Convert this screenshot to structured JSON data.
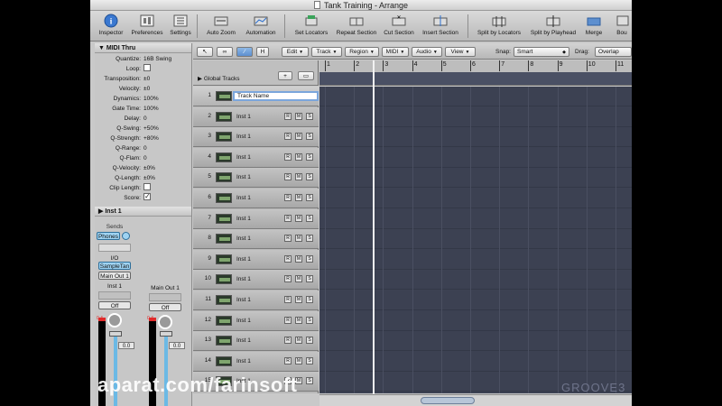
{
  "window": {
    "title": "Tank Training - Arrange"
  },
  "toolbar": {
    "items": [
      {
        "label": "Inspector",
        "icon": "info-icon"
      },
      {
        "label": "Preferences",
        "icon": "preferences-icon"
      },
      {
        "label": "Settings",
        "icon": "settings-icon"
      },
      {
        "label": "Auto Zoom",
        "icon": "auto-zoom-icon"
      },
      {
        "label": "Automation",
        "icon": "automation-icon"
      },
      {
        "label": "Set Locators",
        "icon": "set-locators-icon"
      },
      {
        "label": "Repeat Section",
        "icon": "repeat-section-icon"
      },
      {
        "label": "Cut Section",
        "icon": "cut-section-icon"
      },
      {
        "label": "Insert Section",
        "icon": "insert-section-icon"
      },
      {
        "label": "Split by Locators",
        "icon": "split-locators-icon"
      },
      {
        "label": "Split by Playhead",
        "icon": "split-playhead-icon"
      },
      {
        "label": "Merge",
        "icon": "merge-icon"
      },
      {
        "label": "Bou",
        "icon": "bounce-icon"
      }
    ]
  },
  "inspector": {
    "region_header": "MIDI Thru",
    "params": [
      {
        "label": "Quantize:",
        "value": "16B Swing"
      },
      {
        "label": "Loop:",
        "value": ""
      },
      {
        "label": "Transposition:",
        "value": "±0"
      },
      {
        "label": "Velocity:",
        "value": "±0"
      },
      {
        "label": "Dynamics:",
        "value": "100%"
      },
      {
        "label": "Gate Time:",
        "value": "100%"
      },
      {
        "label": "Delay:",
        "value": "0"
      },
      {
        "label": "Q-Swing:",
        "value": "+50%"
      },
      {
        "label": "Q-Strength:",
        "value": "+80%"
      },
      {
        "label": "Q-Range:",
        "value": "0"
      },
      {
        "label": "Q-Flam:",
        "value": "0"
      },
      {
        "label": "Q-Velocity:",
        "value": "±0%"
      },
      {
        "label": "Q-Length:",
        "value": "±0%"
      },
      {
        "label": "Clip Length:",
        "value": ""
      },
      {
        "label": "Score:",
        "value": ""
      }
    ],
    "score_checked": true,
    "track_header": "Inst 1",
    "strip_left": {
      "sends_label": "Sends",
      "send_button": "Phones",
      "io_label": "I/O",
      "input": "SampleTan",
      "output": "Main Out 1",
      "name": "Inst 1",
      "automation": "Off",
      "meter_top": "0.4",
      "fader_value": "0.0"
    },
    "strip_right": {
      "name": "Main Out 1",
      "automation": "Off",
      "meter_top": "0.4",
      "fader_value": "0.0"
    }
  },
  "arrange_toolbar": {
    "menus": [
      "Edit",
      "Track",
      "Region",
      "MIDI",
      "Audio",
      "View"
    ],
    "snap_label": "Snap:",
    "snap_value": "Smart",
    "drag_label": "Drag:",
    "drag_value": "Overlap"
  },
  "global_tracks_label": "Global Tracks",
  "ruler": {
    "bars": [
      "1",
      "2",
      "3",
      "4",
      "5",
      "6",
      "7",
      "8",
      "9",
      "10",
      "11"
    ]
  },
  "tracks": [
    {
      "num": "1",
      "name": "Track Name",
      "editing": true
    },
    {
      "num": "2",
      "name": "Inst 1"
    },
    {
      "num": "3",
      "name": "Inst 1"
    },
    {
      "num": "4",
      "name": "Inst 1"
    },
    {
      "num": "5",
      "name": "Inst 1"
    },
    {
      "num": "6",
      "name": "Inst 1"
    },
    {
      "num": "7",
      "name": "Inst 1"
    },
    {
      "num": "8",
      "name": "Inst 1"
    },
    {
      "num": "9",
      "name": "Inst 1"
    },
    {
      "num": "10",
      "name": "Inst 1"
    },
    {
      "num": "11",
      "name": "Inst 1"
    },
    {
      "num": "12",
      "name": "Inst 1"
    },
    {
      "num": "13",
      "name": "Inst 1"
    },
    {
      "num": "14",
      "name": "Inst 1"
    },
    {
      "num": "15",
      "name": "Inst 1"
    }
  ],
  "track_buttons": [
    "R",
    "M",
    "S"
  ],
  "watermarks": {
    "left": "aparat.com/farinsoft",
    "right": "GROOVE3"
  },
  "colors": {
    "lane_bg": "#3c4152",
    "selection_blue": "#7ba6dc",
    "meter_red": "#e02a2a",
    "fader_blue": "#6bb9e5"
  }
}
